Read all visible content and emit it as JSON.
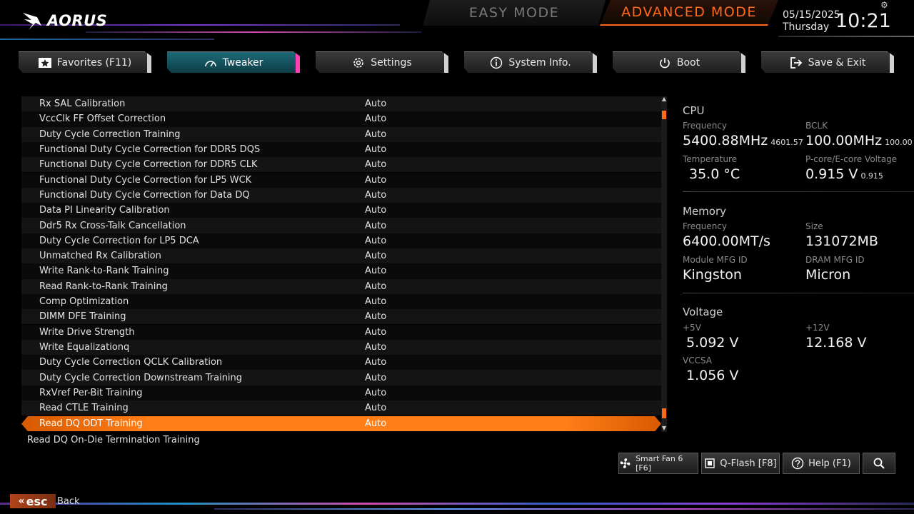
{
  "header": {
    "logo_text": "AORUS",
    "modes": {
      "easy": "EASY MODE",
      "advanced": "ADVANCED MODE"
    },
    "date": "05/15/2025",
    "day": "Thursday",
    "time": "10:21"
  },
  "nav": {
    "tabs": [
      {
        "label": "Favorites (F11)",
        "icon": "star-icon"
      },
      {
        "label": "Tweaker",
        "icon": "speedometer-icon",
        "active": true
      },
      {
        "label": "Settings",
        "icon": "gear-icon"
      },
      {
        "label": "System Info.",
        "icon": "info-icon"
      },
      {
        "label": "Boot",
        "icon": "power-icon"
      },
      {
        "label": "Save & Exit",
        "icon": "exit-icon"
      }
    ]
  },
  "settings_list": {
    "rows": [
      {
        "label": "Rx SAL Calibration",
        "value": "Auto"
      },
      {
        "label": "VccClk FF Offset Correction",
        "value": "Auto"
      },
      {
        "label": "Duty Cycle Correction Training",
        "value": "Auto"
      },
      {
        "label": "Functional Duty Cycle Correction for DDR5 DQS",
        "value": "Auto"
      },
      {
        "label": "Functional Duty Cycle Correction for DDR5 CLK",
        "value": "Auto"
      },
      {
        "label": "Functional Duty Cycle Correction for LP5 WCK",
        "value": "Auto"
      },
      {
        "label": "Functional Duty Cycle Correction for Data DQ",
        "value": "Auto"
      },
      {
        "label": "Data PI Linearity Calibration",
        "value": "Auto"
      },
      {
        "label": "Ddr5 Rx Cross-Talk Cancellation",
        "value": "Auto"
      },
      {
        "label": "Duty Cycle Correction for LP5 DCA",
        "value": "Auto"
      },
      {
        "label": "Unmatched Rx Calibration",
        "value": "Auto"
      },
      {
        "label": "Write Rank-to-Rank Training",
        "value": "Auto"
      },
      {
        "label": "Read Rank-to-Rank Training",
        "value": "Auto"
      },
      {
        "label": "Comp Optimization",
        "value": "Auto"
      },
      {
        "label": "DIMM DFE Training",
        "value": "Auto"
      },
      {
        "label": "Write Drive Strength",
        "value": "Auto"
      },
      {
        "label": "Write Equalizationq",
        "value": "Auto"
      },
      {
        "label": "Duty Cycle Correction QCLK Calibration",
        "value": "Auto"
      },
      {
        "label": "Duty Cycle Correction Downstream Training",
        "value": "Auto"
      },
      {
        "label": "RxVref Per-Bit Training",
        "value": "Auto"
      },
      {
        "label": "Read CTLE Training",
        "value": "Auto"
      },
      {
        "label": "Read DQ ODT Training",
        "value": "Auto",
        "selected": true
      }
    ],
    "description": "Read DQ On-Die Termination Training"
  },
  "system_panel": {
    "cpu": {
      "title": "CPU",
      "frequency_label": "Frequency",
      "frequency": "5400.88MHz",
      "frequency_sub": "4601.57",
      "bclk_label": "BCLK",
      "bclk": "100.00MHz",
      "bclk_sub": "100.00",
      "temp_label": "Temperature",
      "temp": "35.0 °C",
      "voltage_label": "P-core/E-core Voltage",
      "voltage": "0.915 V",
      "voltage_sub": "0.915"
    },
    "memory": {
      "title": "Memory",
      "frequency_label": "Frequency",
      "frequency": "6400.00MT/s",
      "size_label": "Size",
      "size": "131072MB",
      "module_label": "Module MFG ID",
      "module": "Kingston",
      "dram_label": "DRAM MFG ID",
      "dram": "Micron"
    },
    "voltage": {
      "title": "Voltage",
      "v5_label": "+5V",
      "v5": "5.092 V",
      "v12_label": "+12V",
      "v12": "12.168 V",
      "vccsa_label": "VCCSA",
      "vccsa": "1.056 V"
    }
  },
  "bottom_bar": {
    "smart_fan": "Smart Fan 6 [F6]",
    "qflash": "Q-Flash [F8]",
    "help": "Help (F1)",
    "esc_key": "esc",
    "esc_label": "Back"
  },
  "colors": {
    "accent_orange": "#ff6a1a",
    "active_tab": "#1d6b78",
    "active_tab_edge": "#ff3fb4"
  }
}
